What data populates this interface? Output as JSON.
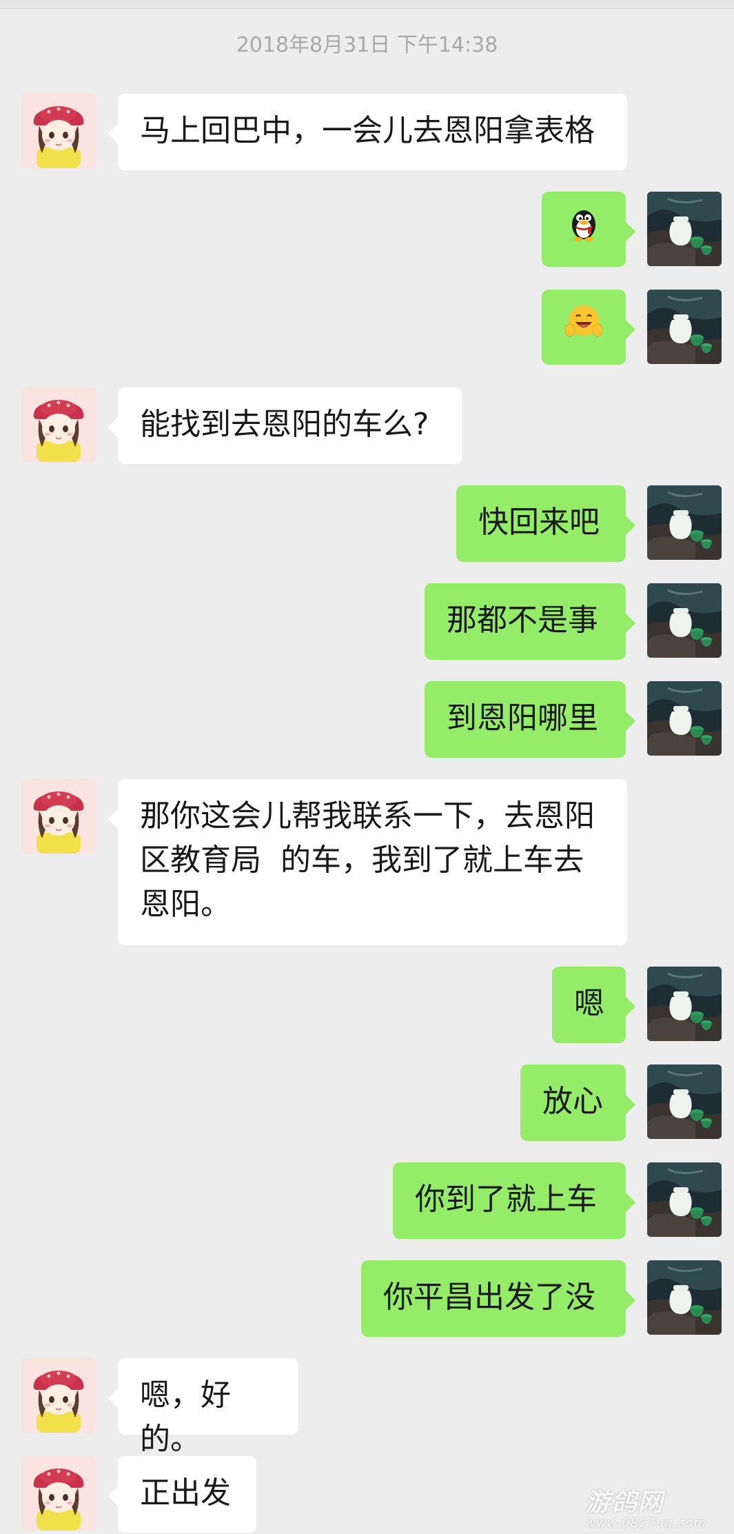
{
  "timestamp": "2018年8月31日 下午14:38",
  "messages": [
    {
      "side": "left",
      "text": "马上回巴中，一会儿去恩阳拿表格"
    },
    {
      "side": "right",
      "emoji": "penguin-icon"
    },
    {
      "side": "right",
      "emoji": "laughing-face-icon"
    },
    {
      "side": "left",
      "text": "能找到去恩阳的车么?"
    },
    {
      "side": "right",
      "text": "快回来吧"
    },
    {
      "side": "right",
      "text": "那都不是事"
    },
    {
      "side": "right",
      "text": "到恩阳哪里"
    },
    {
      "side": "left",
      "lines": [
        "那你这会儿帮我联系一下，去恩阳",
        "区教育局  的车，我到了就上车去",
        "恩阳。"
      ]
    },
    {
      "side": "right",
      "text": "嗯"
    },
    {
      "side": "right",
      "text": "放心"
    },
    {
      "side": "right",
      "text": "你到了就上车"
    },
    {
      "side": "right",
      "text": "你平昌出发了没"
    },
    {
      "side": "left",
      "text": "嗯，好的。"
    },
    {
      "side": "left",
      "text": "正出发"
    }
  ],
  "watermark": {
    "brand": "游鸽网",
    "url": "www.0827ug.com"
  },
  "colors": {
    "background": "#ededed",
    "sent_bubble": "#95ec69",
    "received_bubble": "#ffffff",
    "timestamp": "#a9a9a9"
  }
}
